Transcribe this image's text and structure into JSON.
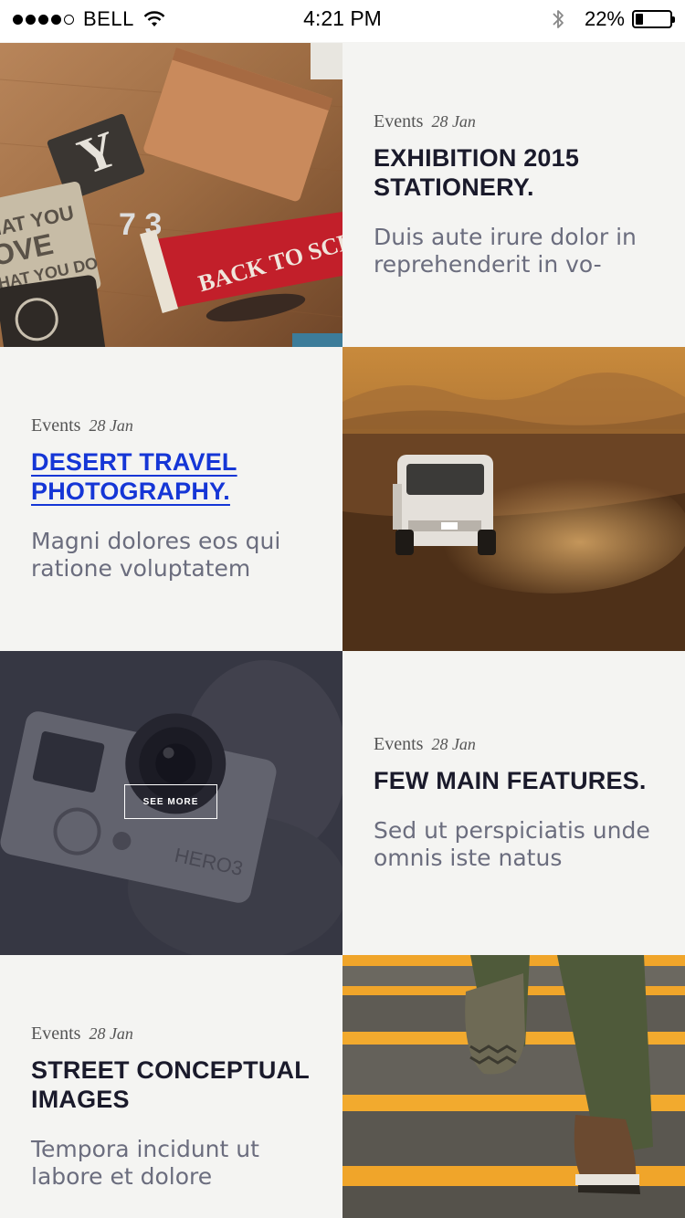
{
  "status_bar": {
    "carrier": "BELL",
    "time": "4:21 PM",
    "battery": "22%",
    "battery_level": 0.22,
    "signal_icon": "signal-dots-icon",
    "wifi_icon": "wifi-icon",
    "bluetooth_icon": "bluetooth-icon"
  },
  "accent_color": "#1536d6",
  "posts": [
    {
      "category": "Events",
      "date": "28 Jan",
      "title": "EXHIBITION 2015 STATIONERY.",
      "excerpt": "Duis aute irure dolor in reprehenderit in vo-"
    },
    {
      "category": "Events",
      "date": "28 Jan",
      "title": "DESERT TRAVEL PHOTOGRAPHY.",
      "excerpt": "Magni dolores eos qui ratione voluptatem"
    },
    {
      "category": "Events",
      "date": "28 Jan",
      "title": "FEW MAIN FEATURES.",
      "excerpt": "Sed ut perspiciatis unde omnis iste natus",
      "overlay_button": "SEE MORE"
    },
    {
      "category": "Events",
      "date": "28 Jan",
      "title": "STREET CONCEPTUAL IMAGES",
      "excerpt": "Tempora incidunt ut labore et dolore"
    }
  ]
}
